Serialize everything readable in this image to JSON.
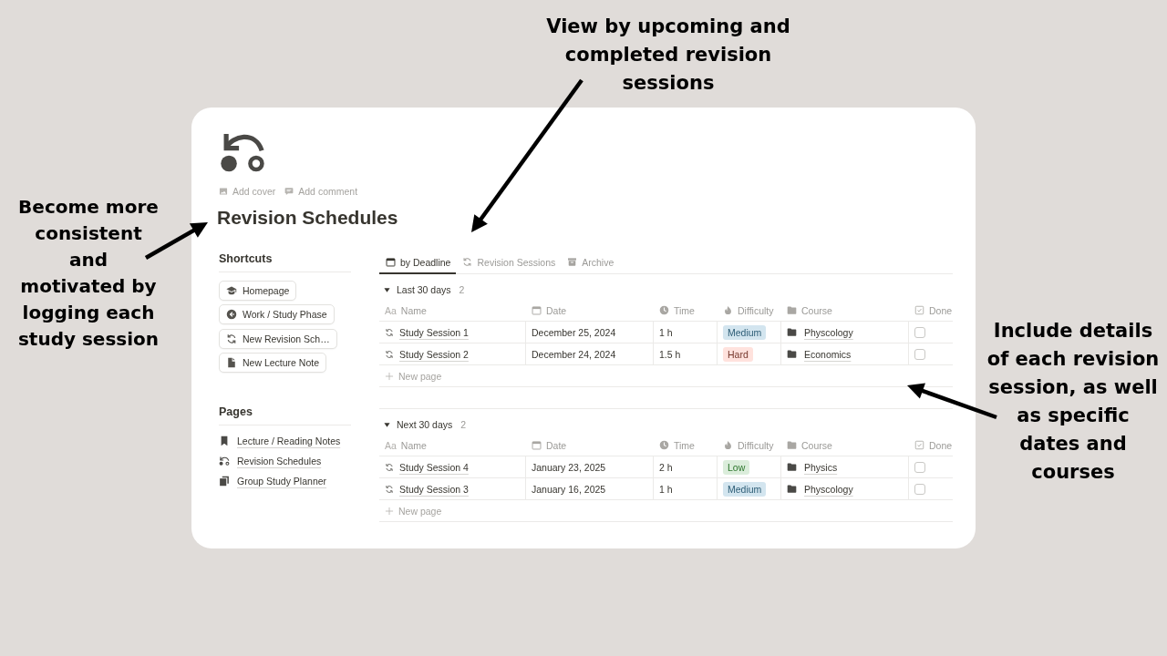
{
  "annotations": [
    "Become more\nconsistent\nand\nmotivated by\nlogging each\nstudy session",
    "View by upcoming and\ncompleted revision\nsessions",
    "Include details\nof each revision\nsession, as well\nas specific\ndates and\ncourses"
  ],
  "page": {
    "actions": [
      "Add cover",
      "Add comment"
    ],
    "title": "Revision Schedules",
    "shortcuts": {
      "heading": "Shortcuts",
      "items": [
        "Homepage",
        "Work / Study Phase",
        "New Revision Sch…",
        "New Lecture Note"
      ]
    },
    "pages": {
      "heading": "Pages",
      "items": [
        "Lecture / Reading Notes",
        "Revision Schedules",
        "Group Study Planner"
      ]
    },
    "tabs": [
      {
        "label": "by Deadline",
        "selected": true
      },
      {
        "label": "Revision Sessions",
        "selected": false
      },
      {
        "label": "Archive",
        "selected": false
      }
    ],
    "groups": [
      {
        "title": "Last 30 days",
        "count": "2",
        "expanded": true,
        "columns": [
          {
            "kind": "title",
            "prefix": "Aa",
            "label": "Name"
          },
          {
            "kind": "date",
            "label": "Date"
          },
          {
            "kind": "time",
            "label": "Time"
          },
          {
            "kind": "select",
            "label": "Difficulty"
          },
          {
            "kind": "relation",
            "label": "Course"
          },
          {
            "kind": "checkbox",
            "label": "Done"
          }
        ],
        "rows": [
          {
            "name": "Study Session 1",
            "date": "December 25, 2024",
            "time": "1 h",
            "difficulty": {
              "label": "Medium",
              "color": "#d3e5ef"
            },
            "course": "Physcology",
            "done": false
          },
          {
            "name": "Study Session 2",
            "date": "December 24, 2024",
            "time": "1.5 h",
            "difficulty": {
              "label": "Hard",
              "color": "#ffe2dd"
            },
            "course": "Economics",
            "done": false
          }
        ],
        "new_row_label": "New page"
      },
      {
        "title": "Next 30 days",
        "count": "2",
        "expanded": true,
        "columns": [
          {
            "kind": "title",
            "prefix": "Aa",
            "label": "Name"
          },
          {
            "kind": "date",
            "label": "Date"
          },
          {
            "kind": "time",
            "label": "Time"
          },
          {
            "kind": "select",
            "label": "Difficulty"
          },
          {
            "kind": "relation",
            "label": "Course"
          },
          {
            "kind": "checkbox",
            "label": "Done"
          }
        ],
        "rows": [
          {
            "name": "Study Session 4",
            "date": "January 23, 2025",
            "time": "2 h",
            "difficulty": {
              "label": "Low",
              "color": "#dbeddb"
            },
            "course": "Physics",
            "done": false
          },
          {
            "name": "Study Session 3",
            "date": "January 16, 2025",
            "time": "1 h",
            "difficulty": {
              "label": "Medium",
              "color": "#d3e5ef"
            },
            "course": "Physcology",
            "done": false
          }
        ],
        "new_row_label": "New page"
      }
    ]
  }
}
